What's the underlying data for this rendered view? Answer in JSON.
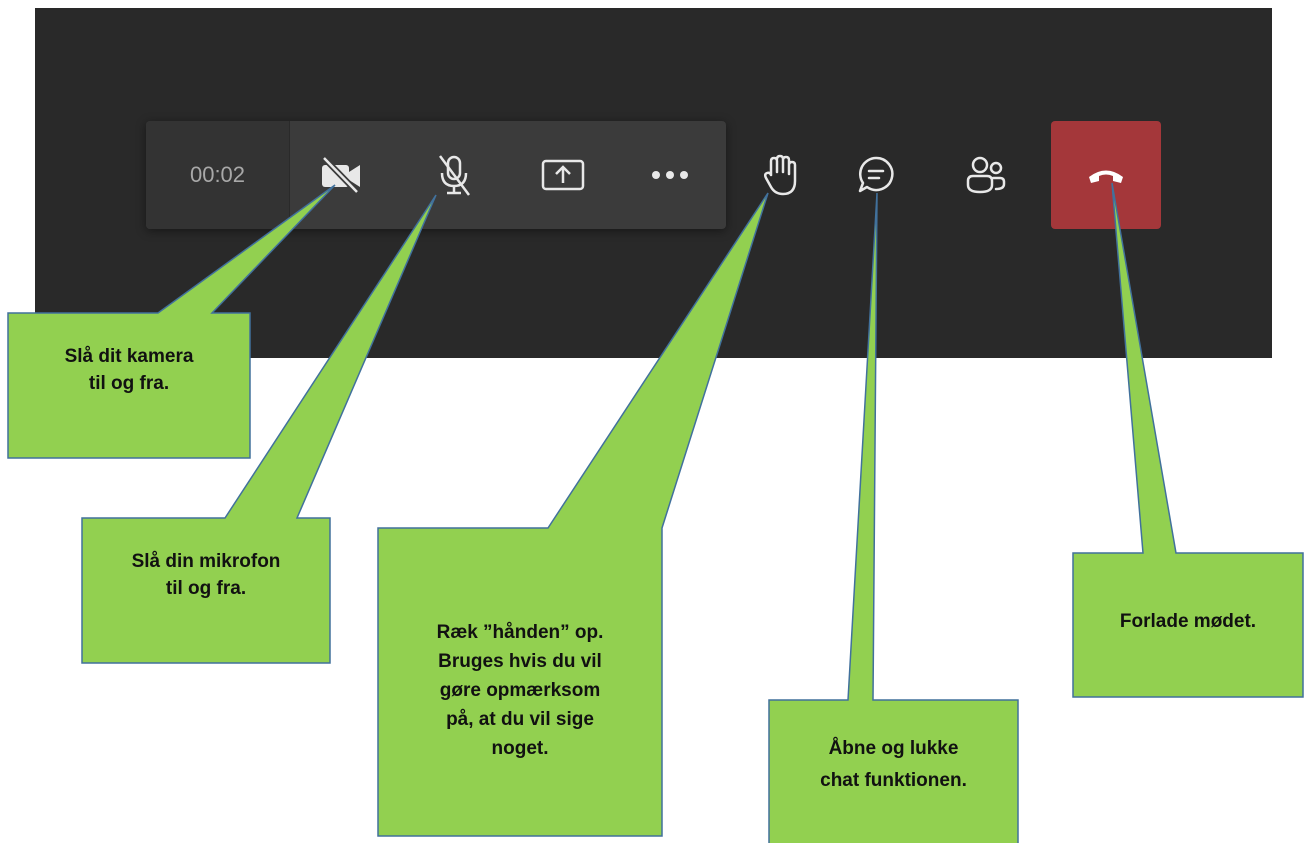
{
  "toolbar": {
    "timer": "00:02",
    "buttons": [
      {
        "name": "camera",
        "icon": "video-off-icon"
      },
      {
        "name": "microphone",
        "icon": "mic-off-icon"
      },
      {
        "name": "share",
        "icon": "share-screen-icon"
      },
      {
        "name": "more",
        "icon": "more-options-icon"
      },
      {
        "name": "raise-hand",
        "icon": "hand-icon"
      },
      {
        "name": "chat",
        "icon": "chat-bubble-icon"
      },
      {
        "name": "participants",
        "icon": "people-icon"
      },
      {
        "name": "leave",
        "icon": "hang-up-icon"
      }
    ]
  },
  "callouts": {
    "camera": [
      "Slå dit kamera",
      "til og fra."
    ],
    "microphone": [
      "Slå din mikrofon",
      "til og fra."
    ],
    "raise_hand": [
      "Ræk ”hånden” op.",
      "Bruges hvis du vil",
      "gøre opmærksom",
      "på, at du vil sige",
      "noget."
    ],
    "chat": [
      "Åbne og lukke",
      "chat funktionen."
    ],
    "leave": [
      "Forlade mødet."
    ]
  },
  "colors": {
    "panel": "#292929",
    "toolbar": "#3b3b3b",
    "leave": "#a4373a",
    "callout_fill": "#92d050",
    "callout_border": "#41719c"
  }
}
